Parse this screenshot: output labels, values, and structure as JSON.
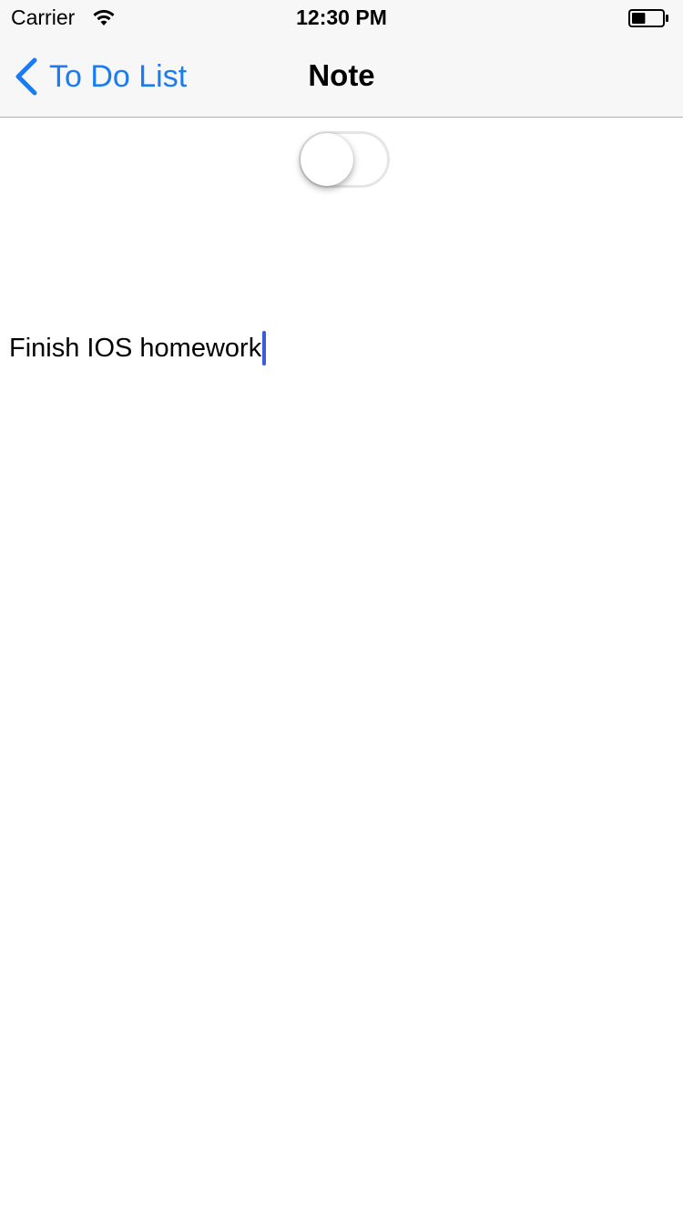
{
  "status_bar": {
    "carrier": "Carrier",
    "time": "12:30 PM",
    "battery_level": 0.45
  },
  "nav": {
    "back_label": "To Do List",
    "title": "Note"
  },
  "toggle": {
    "on": false
  },
  "note": {
    "text": "Finish IOS homework"
  },
  "colors": {
    "accent": "#1a7cf5",
    "caret": "#3b5bdb",
    "bar_background": "#f7f7f7"
  }
}
